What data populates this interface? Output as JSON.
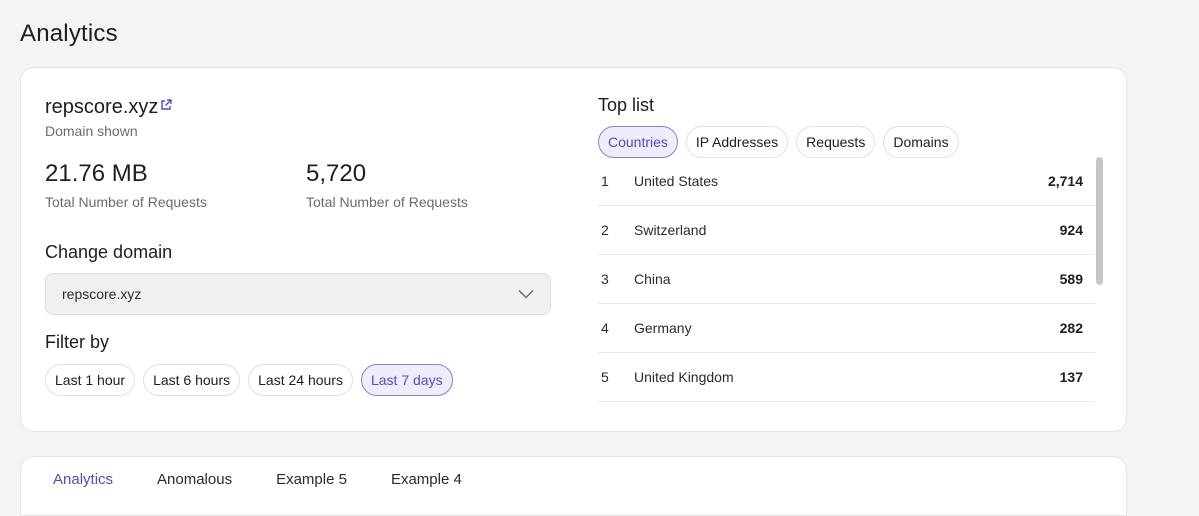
{
  "page_title": "Analytics",
  "domain": {
    "name": "repscore.xyz",
    "subtitle": "Domain shown"
  },
  "stats": [
    {
      "value": "21.76 MB",
      "label": "Total Number of Requests"
    },
    {
      "value": "5,720",
      "label": "Total Number of Requests"
    }
  ],
  "change_domain": {
    "heading": "Change domain",
    "selected": "repscore.xyz"
  },
  "filter": {
    "heading": "Filter by",
    "options": [
      "Last 1 hour",
      "Last 6 hours",
      "Last 24 hours",
      "Last 7 days"
    ],
    "active": "Last 7 days"
  },
  "toplist": {
    "title": "Top list",
    "tabs": [
      "Countries",
      "IP Addresses",
      "Requests",
      "Domains"
    ],
    "active_tab": "Countries",
    "rows": [
      {
        "rank": "1",
        "name": "United States",
        "count": "2,714"
      },
      {
        "rank": "2",
        "name": "Switzerland",
        "count": "924"
      },
      {
        "rank": "3",
        "name": "China",
        "count": "589"
      },
      {
        "rank": "4",
        "name": "Germany",
        "count": "282"
      },
      {
        "rank": "5",
        "name": "United Kingdom",
        "count": "137"
      }
    ]
  },
  "bottom_tabs": [
    "Analytics",
    "Anomalous",
    "Example 5",
    "Example 4"
  ],
  "colors": {
    "accent": "#5b48c4",
    "accent_bg": "#efecfb"
  }
}
